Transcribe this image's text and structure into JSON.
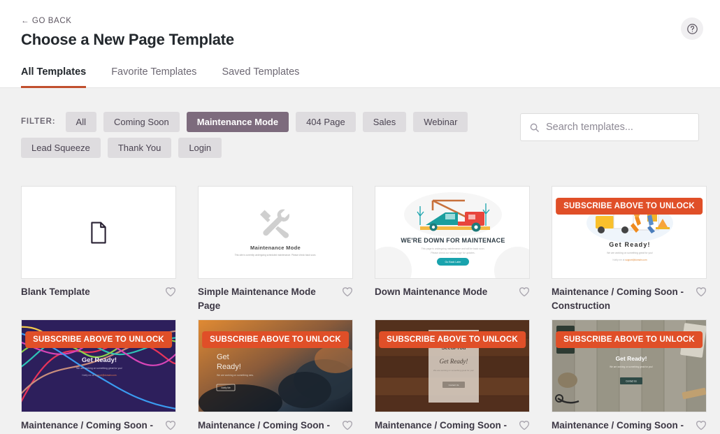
{
  "header": {
    "go_back": "← GO BACK",
    "title": "Choose a New Page Template",
    "help_icon": "help-circle-icon"
  },
  "tabs": [
    {
      "label": "All Templates",
      "active": true
    },
    {
      "label": "Favorite Templates",
      "active": false
    },
    {
      "label": "Saved Templates",
      "active": false
    }
  ],
  "filter": {
    "label": "FILTER:",
    "chips": [
      {
        "label": "All",
        "active": false
      },
      {
        "label": "Coming Soon",
        "active": false
      },
      {
        "label": "Maintenance Mode",
        "active": true
      },
      {
        "label": "404 Page",
        "active": false
      },
      {
        "label": "Sales",
        "active": false
      },
      {
        "label": "Webinar",
        "active": false
      },
      {
        "label": "Lead Squeeze",
        "active": false
      },
      {
        "label": "Thank You",
        "active": false
      },
      {
        "label": "Login",
        "active": false
      }
    ]
  },
  "search": {
    "placeholder": "Search templates...",
    "value": "",
    "icon": "search-icon"
  },
  "colors": {
    "accent_orange": "#c1502e",
    "badge_orange": "#e04f28",
    "active_chip": "#7d6b7d",
    "chip": "#dedcdf",
    "page_bg": "#f1f1f1"
  },
  "badge_text": "SUBSCRIBE ABOVE TO UNLOCK",
  "templates": [
    {
      "title": "Blank Template",
      "locked": false,
      "style": "blank",
      "preview": {
        "headline": "",
        "sub": "",
        "button": ""
      }
    },
    {
      "title": "Simple Maintenance Mode Page",
      "locked": false,
      "style": "simple-maintenance",
      "preview": {
        "headline": "Maintenance Mode",
        "sub": "This site is currently undergoing scheduled maintenance. Please check back soon.",
        "button": ""
      }
    },
    {
      "title": "Down Maintenance Mode",
      "locked": false,
      "style": "tow-truck",
      "preview": {
        "headline": "WE'RE DOWN FOR MAINTENACE",
        "sub": "This page is undergoing maintenance and will be back soon. Please check our status page for updates.",
        "button": "Go Back Later"
      }
    },
    {
      "title": "Maintenance / Coming Soon - Construction",
      "locked": true,
      "style": "construction",
      "preview": {
        "headline": "Get Ready!",
        "sub": "We are working on something great for you!",
        "button": ""
      }
    },
    {
      "title": "Maintenance / Coming Soon -",
      "locked": true,
      "style": "purple-waves",
      "preview": {
        "headline": "Get Ready!",
        "sub": "We are working on something great for you!",
        "button": ""
      }
    },
    {
      "title": "Maintenance / Coming Soon -",
      "locked": true,
      "style": "clouds",
      "preview": {
        "headline": "Get Ready!",
        "sub": "We are working on something new.",
        "button": "Notify Me"
      }
    },
    {
      "title": "Maintenance / Coming Soon -",
      "locked": true,
      "style": "dark-wood",
      "preview": {
        "headline": "Get Ready!",
        "sub": "We are working on something great for you!",
        "button": "Contact Us"
      }
    },
    {
      "title": "Maintenance / Coming Soon -",
      "locked": true,
      "style": "light-wood",
      "preview": {
        "headline": "Get Ready!",
        "sub": "We are working on something great for you!",
        "button": "Contact Us"
      }
    }
  ]
}
